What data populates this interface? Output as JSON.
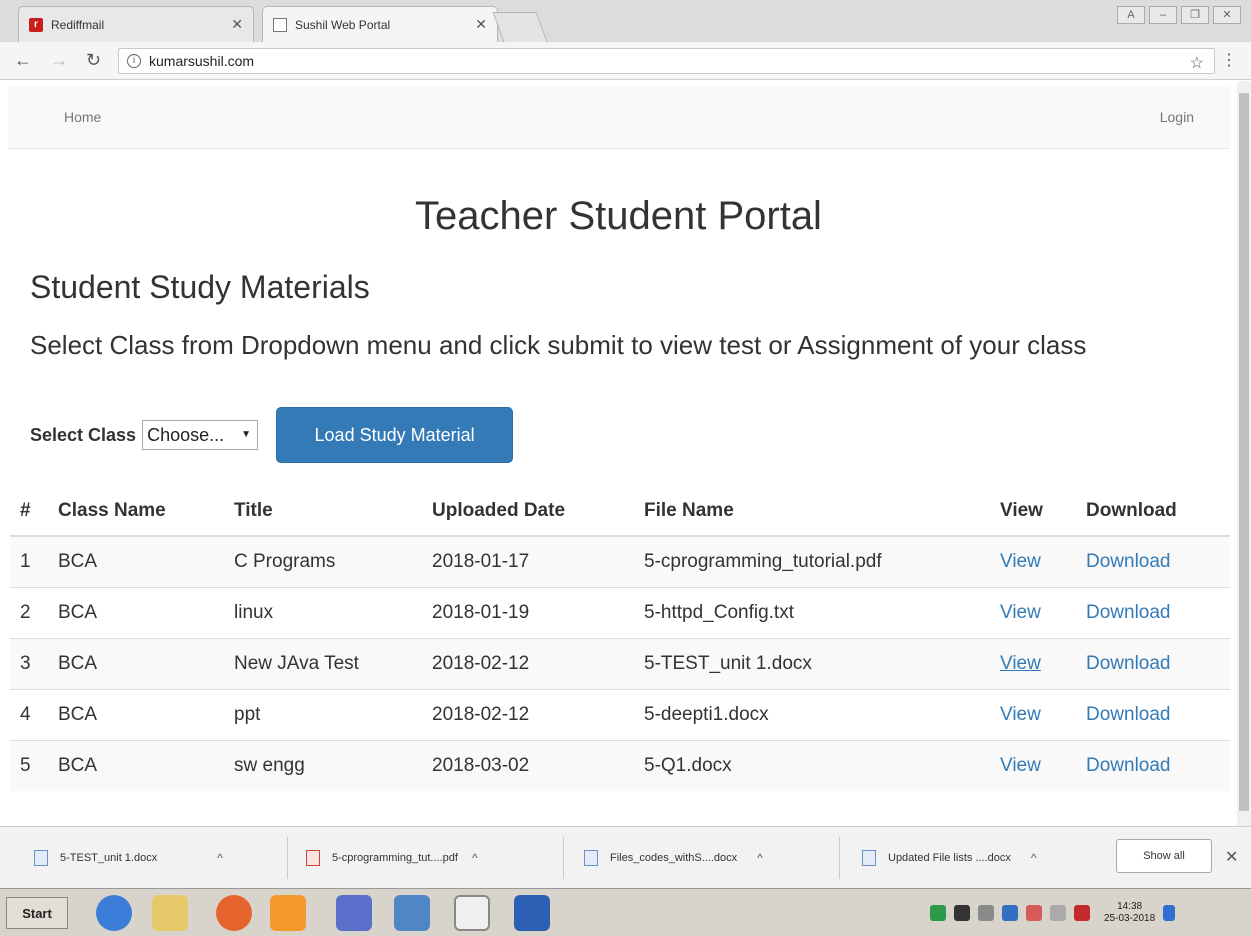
{
  "browser": {
    "tabs": [
      {
        "label": "Rediffmail"
      },
      {
        "label": "Sushil Web Portal"
      }
    ],
    "url": "kumarsushil.com"
  },
  "navbar": {
    "home": "Home",
    "login": "Login"
  },
  "page": {
    "title": "Teacher Student Portal",
    "subtitle": "Student Study Materials",
    "instruction": "Select Class from Dropdown menu and click submit to view test or Assignment of your class",
    "select_label": "Select Class",
    "select_value": "Choose...",
    "button_label": "Load Study Material"
  },
  "table": {
    "headers": [
      "#",
      "Class Name",
      "Title",
      "Uploaded Date",
      "File Name",
      "View",
      "Download"
    ],
    "rows": [
      {
        "num": "1",
        "class": "BCA",
        "title": "C Programs",
        "date": "2018-01-17",
        "file": "5-cprogramming_tutorial.pdf",
        "view": "View",
        "download": "Download"
      },
      {
        "num": "2",
        "class": "BCA",
        "title": "linux",
        "date": "2018-01-19",
        "file": "5-httpd_Config.txt",
        "view": "View",
        "download": "Download"
      },
      {
        "num": "3",
        "class": "BCA",
        "title": "New JAva Test",
        "date": "2018-02-12",
        "file": "5-TEST_unit 1.docx",
        "view": "View",
        "download": "Download"
      },
      {
        "num": "4",
        "class": "BCA",
        "title": "ppt",
        "date": "2018-02-12",
        "file": "5-deepti1.docx",
        "view": "View",
        "download": "Download"
      },
      {
        "num": "5",
        "class": "BCA",
        "title": "sw engg",
        "date": "2018-03-02",
        "file": "5-Q1.docx",
        "view": "View",
        "download": "Download"
      }
    ]
  },
  "downloads": {
    "items": [
      {
        "name": "5-TEST_unit 1.docx"
      },
      {
        "name": "5-cprogramming_tut....pdf"
      },
      {
        "name": "Files_codes_withS....docx"
      },
      {
        "name": "Updated File lists ....docx"
      }
    ],
    "show_all": "Show all"
  },
  "taskbar": {
    "start": "Start",
    "time": "14:38",
    "date": "25-03-2018"
  },
  "colors": {
    "link": "#337ab7",
    "button": "#337ab7",
    "text": "#333333"
  }
}
